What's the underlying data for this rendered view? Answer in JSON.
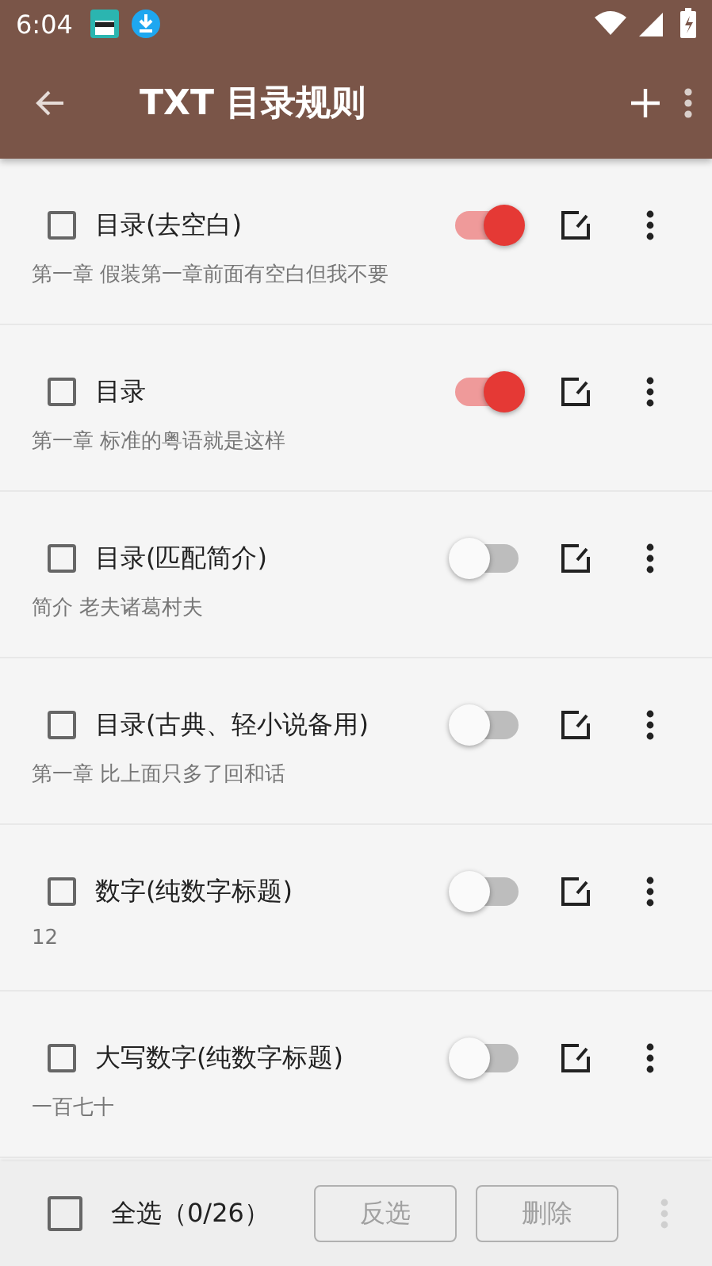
{
  "status_bar": {
    "time": "6:04"
  },
  "toolbar": {
    "title": "TXT 目录规则"
  },
  "rules": [
    {
      "name": "目录(去空白)",
      "example": "第一章 假装第一章前面有空白但我不要",
      "checked": false,
      "on": true
    },
    {
      "name": "目录",
      "example": "第一章 标准的粤语就是这样",
      "checked": false,
      "on": true
    },
    {
      "name": "目录(匹配简介)",
      "example": "简介 老夫诸葛村夫",
      "checked": false,
      "on": false
    },
    {
      "name": "目录(古典、轻小说备用)",
      "example": "第一章 比上面只多了回和话",
      "checked": false,
      "on": false
    },
    {
      "name": "数字(纯数字标题)",
      "example": "12",
      "checked": false,
      "on": false
    },
    {
      "name": "大写数字(纯数字标题)",
      "example": "一百七十",
      "checked": false,
      "on": false
    }
  ],
  "bottom_bar": {
    "select_all": {
      "label": "全选（0/26）",
      "checked": false
    },
    "buttons": [
      {
        "label": "反选",
        "disabled": true
      },
      {
        "label": "删除",
        "disabled": true
      }
    ],
    "menu_disabled": true
  }
}
